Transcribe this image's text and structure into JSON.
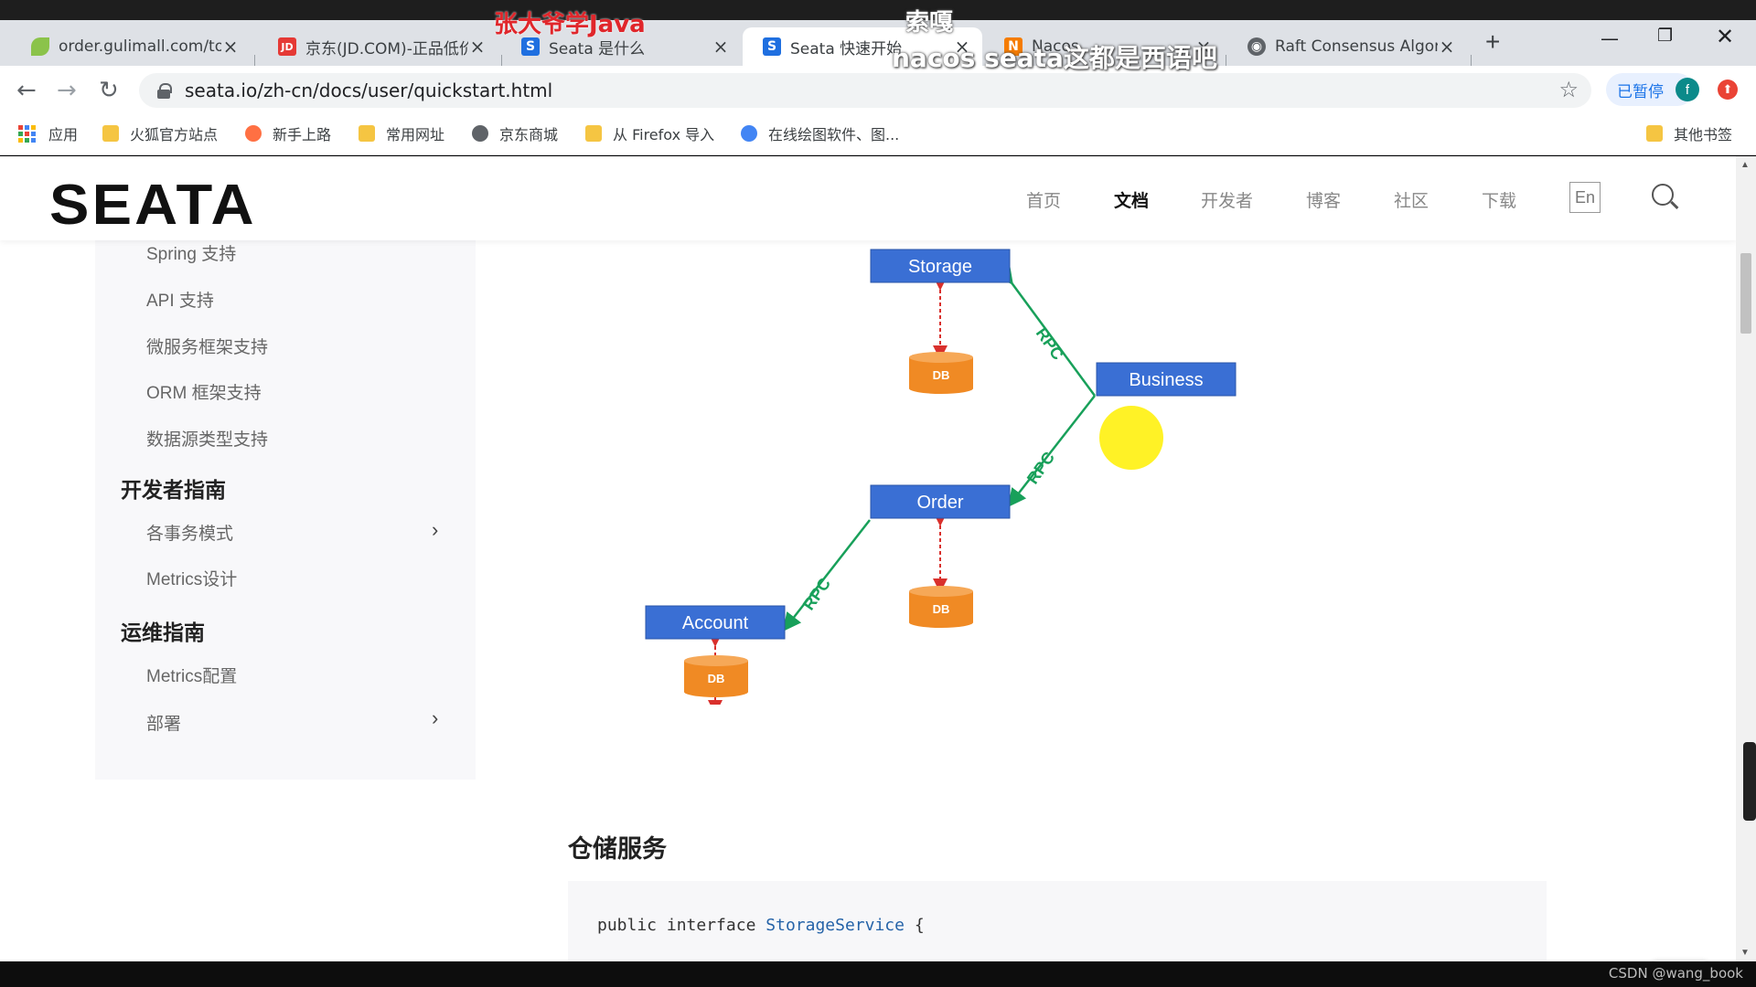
{
  "overlay": {
    "watermark_red": "张大爷学Java",
    "caption_top": "索嘎",
    "subtitle": "nacos  seata这都是西语吧",
    "corner_mark": "CSDN @wang_book"
  },
  "browser": {
    "tabs": [
      {
        "title": "order.gulimall.com/to",
        "favicon": "leaf-icon",
        "color": "#7cb342",
        "glyph": ""
      },
      {
        "title": "京东(JD.COM)-正品低价",
        "favicon": "jd-icon",
        "color": "#e53935",
        "glyph": "JD"
      },
      {
        "title": "Seata 是什么",
        "favicon": "seata-icon",
        "color": "#1f6fe0",
        "glyph": "S"
      },
      {
        "title": "Seata 快速开始",
        "favicon": "seata-icon",
        "color": "#1f6fe0",
        "glyph": "S"
      },
      {
        "title": "Nacos",
        "favicon": "nacos-icon",
        "color": "#f57c00",
        "glyph": "N"
      },
      {
        "title": "Raft Consensus Algor",
        "favicon": "globe-icon",
        "color": "#5f6368",
        "glyph": "◉"
      }
    ],
    "url": "seata.io/zh-cn/docs/user/quickstart.html",
    "paused_label": "已暂停",
    "avatar_letter": "f",
    "bookmarks": [
      "应用",
      "火狐官方站点",
      "新手上路",
      "常用网址",
      "京东商城",
      "从 Firefox 导入",
      "在线绘图软件、图...",
      "其他书签"
    ]
  },
  "site": {
    "logo": "SEATA",
    "nav": [
      "首页",
      "文档",
      "开发者",
      "博客",
      "社区",
      "下载"
    ],
    "lang": "En",
    "sidebar": {
      "items_top": [
        "Spring 支持",
        "API 支持",
        "微服务框架支持",
        "ORM 框架支持",
        "数据源类型支持"
      ],
      "heading_dev": "开发者指南",
      "items_dev": [
        "各事务模式",
        "Metrics设计"
      ],
      "heading_ops": "运维指南",
      "items_ops": [
        "Metrics配置",
        "部署"
      ]
    },
    "diagram": {
      "nodes": [
        "Storage",
        "Business",
        "Order",
        "Account"
      ],
      "db_label": "DB",
      "edge_label": "RPC"
    },
    "section_title": "仓储服务",
    "code": {
      "kw1": "public",
      "kw2": "interface",
      "type": "StorageService",
      "brace": "{"
    }
  },
  "colors": {
    "node_fill": "#3a6fd4",
    "db_fill": "#f08a24",
    "edge": "#18a05a",
    "dashed": "#d9302c"
  }
}
